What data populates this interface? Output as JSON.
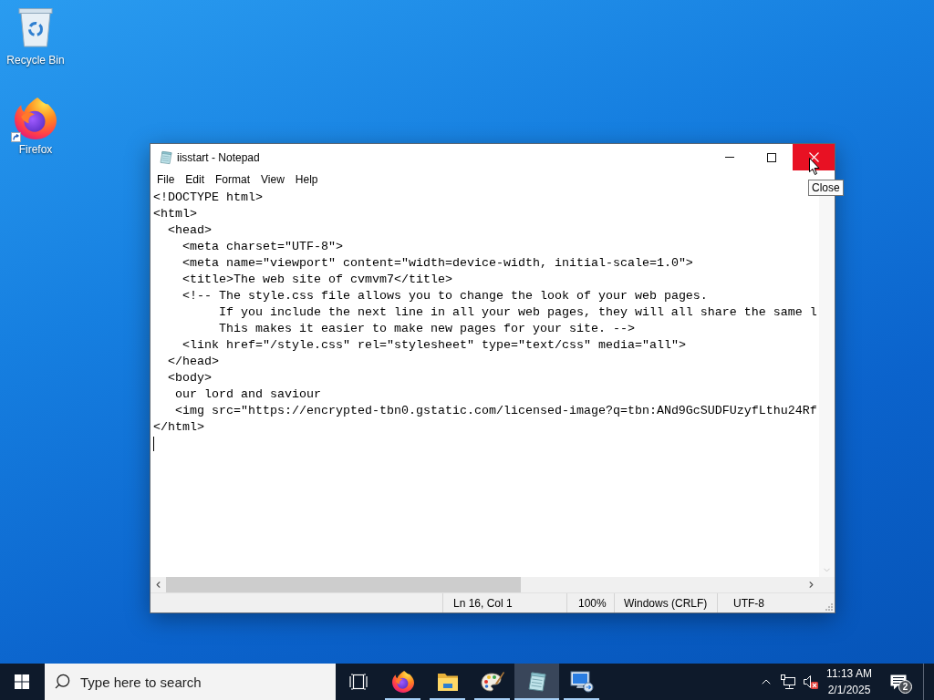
{
  "desktop": {
    "icons": [
      {
        "kind": "recycle-bin",
        "label": "Recycle Bin",
        "shortcut": false
      },
      {
        "kind": "firefox",
        "label": "Firefox",
        "shortcut": true
      }
    ]
  },
  "window": {
    "title": "iisstart - Notepad",
    "caption_buttons": [
      {
        "kind": "minimize",
        "hovered": false
      },
      {
        "kind": "maximize",
        "hovered": false
      },
      {
        "kind": "close",
        "hovered": true
      }
    ],
    "tooltip": "Close",
    "menu": [
      "File",
      "Edit",
      "Format",
      "View",
      "Help"
    ],
    "editor": {
      "lines": [
        "<!DOCTYPE html>",
        "<html>",
        "  <head>",
        "    <meta charset=\"UTF-8\">",
        "    <meta name=\"viewport\" content=\"width=device-width, initial-scale=1.0\">",
        "    <title>The web site of cvmvm7</title>",
        "    <!-- The style.css file allows you to change the look of your web pages.",
        "         If you include the next line in all your web pages, they will all share the same l",
        "         This makes it easier to make new pages for your site. -->",
        "    <link href=\"/style.css\" rel=\"stylesheet\" type=\"text/css\" media=\"all\">",
        "  </head>",
        "  <body>",
        "   our lord and saviour",
        "   <img src=\"https://encrypted-tbn0.gstatic.com/licensed-image?q=tbn:ANd9GcSUDFUzyfLthu24Rf",
        "</html>"
      ],
      "caret": true
    },
    "status_bar": {
      "position": "Ln 16, Col 1",
      "zoom": "100%",
      "line_ending": "Windows (CRLF)",
      "encoding": "UTF-8"
    }
  },
  "taskbar": {
    "search": {
      "placeholder": "Type here to search"
    },
    "apps": [
      {
        "kind": "firefox",
        "running": true,
        "selected": false
      },
      {
        "kind": "file-explorer",
        "running": true,
        "selected": false
      },
      {
        "kind": "paint",
        "running": true,
        "selected": false
      },
      {
        "kind": "notepad",
        "running": true,
        "selected": true
      },
      {
        "kind": "remote-desktop",
        "running": true,
        "selected": false
      }
    ],
    "tray": {
      "volume_muted": true,
      "time": "11:13 AM",
      "date": "2/1/2025",
      "notification_count": "2"
    }
  }
}
